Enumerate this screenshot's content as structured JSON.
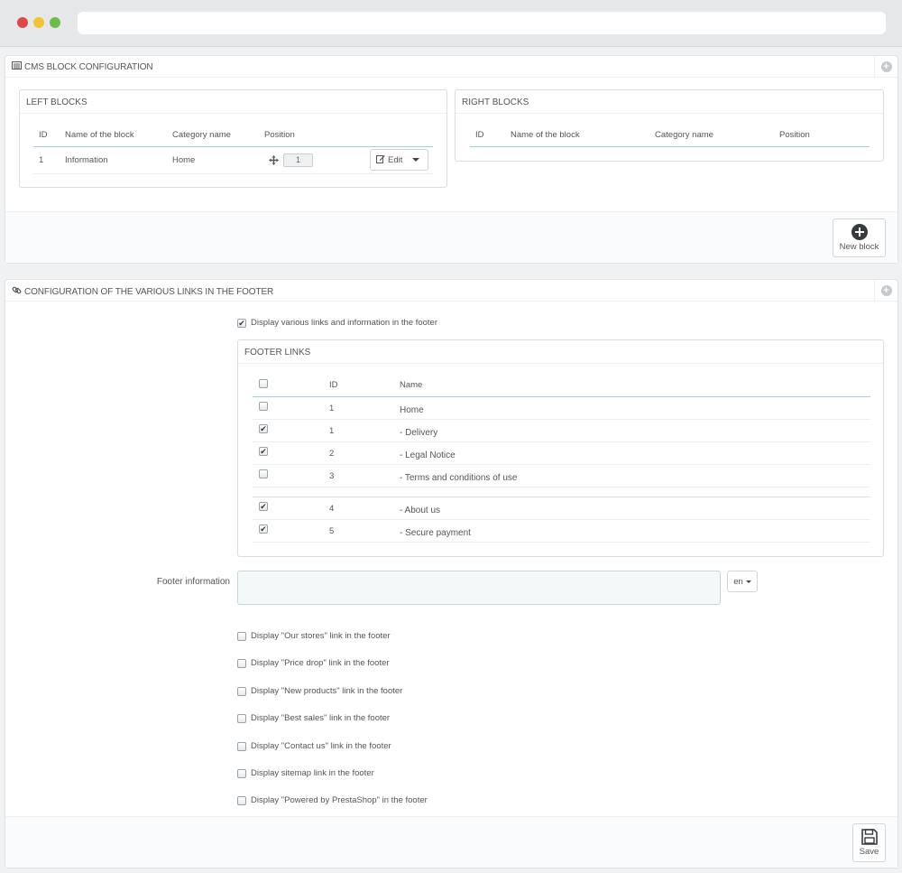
{
  "cms_panel": {
    "title": "CMS BLOCK CONFIGURATION",
    "left": {
      "title": "LEFT BLOCKS",
      "columns": [
        "ID",
        "Name of the block",
        "Category name",
        "Position"
      ],
      "rows": [
        {
          "id": "1",
          "name": "Information",
          "category": "Home",
          "position": "1"
        }
      ],
      "edit_label": "Edit"
    },
    "right": {
      "title": "RIGHT BLOCKS",
      "columns": [
        "ID",
        "Name of the block",
        "Category name",
        "Position"
      ]
    },
    "new_block_label": "New block"
  },
  "footer_panel": {
    "title": "CONFIGURATION OF THE VARIOUS LINKS IN THE FOOTER",
    "display_toggle": {
      "label": "Display various links and information in the footer",
      "checked": true
    },
    "links": {
      "title": "FOOTER LINKS",
      "columns": [
        "ID",
        "Name"
      ],
      "rows": [
        {
          "id": "1",
          "name": "Home",
          "checked": false
        },
        {
          "id": "1",
          "name": "- Delivery",
          "checked": true
        },
        {
          "id": "2",
          "name": "- Legal Notice",
          "checked": true
        },
        {
          "id": "3",
          "name": "- Terms and conditions of use",
          "checked": false
        },
        {
          "id": "4",
          "name": "- About us",
          "checked": true
        },
        {
          "id": "5",
          "name": "- Secure payment",
          "checked": true
        }
      ]
    },
    "footer_info_label": "Footer information",
    "lang": "en",
    "options": [
      {
        "label": "Display \"Our stores\" link in the footer",
        "checked": false
      },
      {
        "label": "Display \"Price drop\" link in the footer",
        "checked": false
      },
      {
        "label": "Display \"New products\" link in the footer",
        "checked": false
      },
      {
        "label": "Display \"Best sales\" link in the footer",
        "checked": false
      },
      {
        "label": "Display \"Contact us\" link in the footer",
        "checked": false
      },
      {
        "label": "Display sitemap link in the footer",
        "checked": false
      },
      {
        "label": "Display \"Powered by PrestaShop\" in the footer",
        "checked": false
      }
    ],
    "save_label": "Save"
  }
}
